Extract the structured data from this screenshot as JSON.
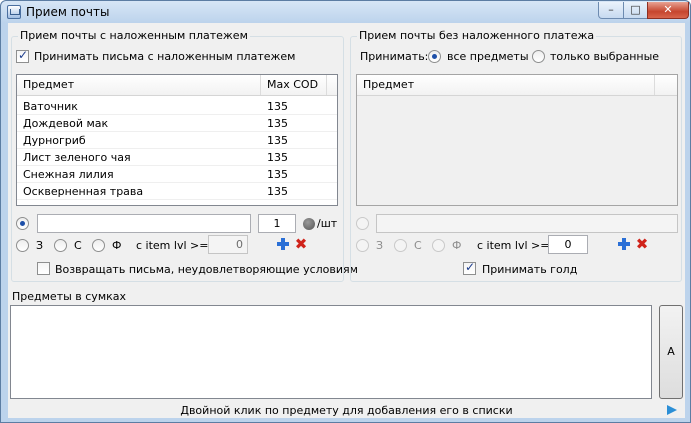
{
  "window": {
    "title": "Прием почты",
    "minimize": "–",
    "maximize": "□",
    "close": "✕"
  },
  "cod_group": {
    "title": "Прием почты с наложенным платежем",
    "accept_checkbox_label": "Принимать письма с наложенным платежем",
    "accept_checked": true,
    "columns": [
      "Предмет",
      "Max COD"
    ],
    "rows": [
      {
        "item": "Ваточник",
        "max_cod": "135"
      },
      {
        "item": "Дождевой мак",
        "max_cod": "135"
      },
      {
        "item": "Дурногриб",
        "max_cod": "135"
      },
      {
        "item": "Лист зеленого чая",
        "max_cod": "135"
      },
      {
        "item": "Снежная лилия",
        "max_cod": "135"
      },
      {
        "item": "Оскверненная трава",
        "max_cod": "135"
      }
    ],
    "name_value": "",
    "amount_value": "1",
    "per_unit_label": "/шт",
    "quality_options": [
      "З",
      "С",
      "Ф"
    ],
    "item_lvl_label": "c item lvl >=",
    "item_lvl_value": "0",
    "return_label": "Возвращать письма, неудовлетворяющие условиям",
    "return_checked": false
  },
  "nocod_group": {
    "title": "Прием почты без наложенного платежа",
    "accept_label": "Принимать:",
    "option_all": "все предметы",
    "option_selected": "только выбранные",
    "column": "Предмет",
    "name_value": "",
    "quality_options": [
      "З",
      "С",
      "Ф"
    ],
    "item_lvl_label": "c item lvl >=",
    "item_lvl_value": "0",
    "accept_gold_label": "Принимать голд",
    "accept_gold_checked": true
  },
  "bags_group": {
    "title": "Предметы в сумках",
    "side_button_label": "A",
    "hint": "Двойной клик по предмету для добавления его в списки"
  },
  "colors": {
    "accent_plus": "#2a6fd6",
    "delete_red": "#d0231a",
    "play": "#2c8fd6"
  }
}
